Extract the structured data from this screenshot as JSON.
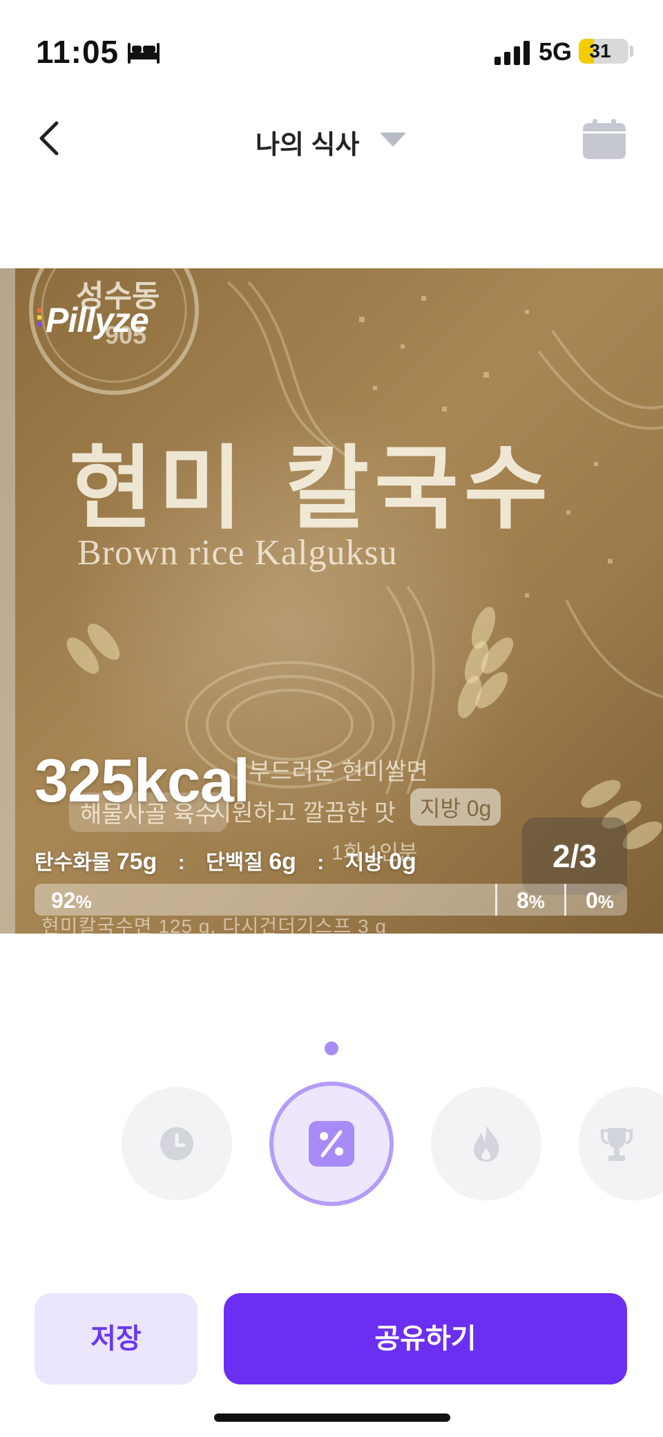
{
  "status_bar": {
    "time": "11:05",
    "network": "5G",
    "battery": "31",
    "battery_level": 0.31
  },
  "nav": {
    "title": "나의 식사"
  },
  "photo": {
    "logo": "Pillyze",
    "package": {
      "stamp_text": "성수동",
      "stamp_num": "905",
      "title_ko": "현미 칼국수",
      "title_en": "Brown rice Kalguksu",
      "sub1": "부드러운 현미쌀면",
      "tag1": "해물사골 육수",
      "sub2": "시원하고 깔끔한 맛",
      "tag2": "지방 0g",
      "sub3": "1회 1인분",
      "sub4": "현미칼국수면 125 g, 다시건더기스프 3 g"
    },
    "overlay": {
      "calories": "325kcal",
      "carb_label": "탄수화물",
      "carb_value": "75g",
      "protein_label": "단백질",
      "protein_value": "6g",
      "fat_label": "지방",
      "fat_value": "0g",
      "separator": ":",
      "page_indicator": "2/3",
      "ratio": {
        "carb_pct": 92,
        "protein_pct": 8,
        "fat_pct": 0,
        "carb_label": "92",
        "protein_label": "8",
        "fat_label": "0",
        "unit": "%"
      }
    }
  },
  "templates": [
    {
      "icon": "clock-icon",
      "selected": false
    },
    {
      "icon": "percent-icon",
      "selected": true
    },
    {
      "icon": "flame-icon",
      "selected": false
    },
    {
      "icon": "trophy-icon",
      "selected": false
    }
  ],
  "actions": {
    "save_label": "저장",
    "share_label": "공유하기"
  },
  "colors": {
    "accent": "#6b2ff1",
    "accent_light": "#ebe5fd",
    "selected_ring": "#b59cf6"
  }
}
